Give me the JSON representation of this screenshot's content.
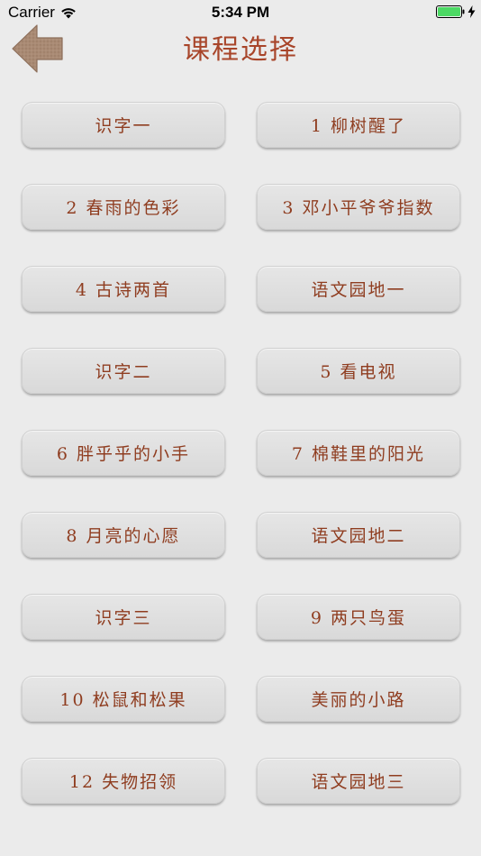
{
  "status_bar": {
    "carrier": "Carrier",
    "time": "5:34 PM",
    "battery_color": "#4cd964"
  },
  "header": {
    "title": "课程选择",
    "back_icon": "back-arrow-icon",
    "accent_color": "#a8452a"
  },
  "courses": [
    "识字一",
    "1 柳树醒了",
    "2 春雨的色彩",
    "3 邓小平爷爷指数",
    "4 古诗两首",
    "语文园地一",
    "识字二",
    "5 看电视",
    "6 胖乎乎的小手",
    "7 棉鞋里的阳光",
    "8 月亮的心愿",
    "语文园地二",
    "识字三",
    "9 两只鸟蛋",
    "10 松鼠和松果",
    "美丽的小路",
    "12 失物招领",
    "语文园地三"
  ]
}
